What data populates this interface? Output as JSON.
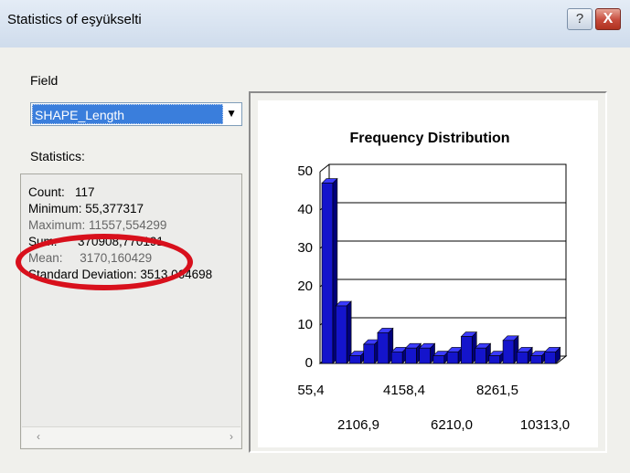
{
  "window": {
    "title": "Statistics of eşyükselti",
    "help_label": "?",
    "close_label": "X"
  },
  "field": {
    "label": "Field",
    "selected": "SHAPE_Length",
    "dropdown_arrow": "▼"
  },
  "statistics": {
    "label": "Statistics:",
    "count": "Count:   117",
    "minimum": "Minimum: 55,377317",
    "maximum": "Maximum: 11557,554299",
    "sum": "Sum:      370908,770191",
    "mean": "Mean:     3170,160429",
    "std": "Standard Deviation: 3513,064698",
    "scroll_left": "‹",
    "scroll_right": "›"
  },
  "colors": {
    "bar": "#1414cc",
    "bar_dark": "#00007a",
    "annotation": "#d8101c",
    "selection": "#3a7edc"
  },
  "chart_data": {
    "type": "bar",
    "title": "Frequency Distribution",
    "xlabel": "",
    "ylabel": "",
    "ylim": [
      0,
      50
    ],
    "y_ticks": [
      "50",
      "40",
      "30",
      "20",
      "10",
      "0"
    ],
    "x_tick_labels_row1": [
      "55,4",
      "4158,4",
      "8261,5"
    ],
    "x_tick_labels_row2": [
      "2106,9",
      "6210,0",
      "10313,0"
    ],
    "values": [
      47,
      15,
      2,
      5,
      8,
      3,
      4,
      4,
      2,
      3,
      7,
      4,
      2,
      6,
      3,
      2,
      3
    ]
  }
}
